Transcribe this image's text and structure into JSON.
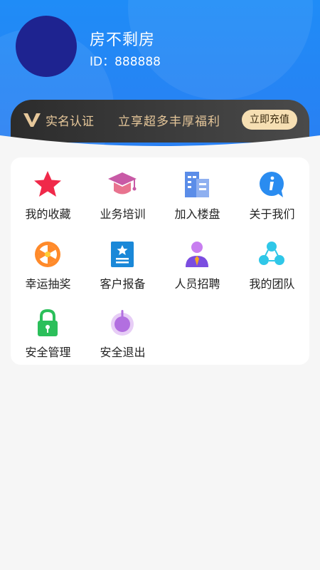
{
  "profile": {
    "name": "房不剩房",
    "id_text": "ID：888888"
  },
  "vip": {
    "label": "实名认证",
    "slogan": "立享超多丰厚福利",
    "button": "立即充值"
  },
  "menu": [
    {
      "label": "我的收藏",
      "icon": "star-icon"
    },
    {
      "label": "业务培训",
      "icon": "graduation-cap-icon"
    },
    {
      "label": "加入楼盘",
      "icon": "building-icon"
    },
    {
      "label": "关于我们",
      "icon": "info-icon"
    },
    {
      "label": "幸运抽奖",
      "icon": "wheel-icon"
    },
    {
      "label": "客户报备",
      "icon": "report-icon"
    },
    {
      "label": "人员招聘",
      "icon": "recruit-person-icon"
    },
    {
      "label": "我的团队",
      "icon": "team-icon"
    },
    {
      "label": "安全管理",
      "icon": "lock-icon"
    },
    {
      "label": "安全退出",
      "icon": "power-icon"
    }
  ],
  "colors": {
    "header": "#1f8cf7",
    "vip_gold": "#e6c79a",
    "avatar": "#1e2390"
  }
}
